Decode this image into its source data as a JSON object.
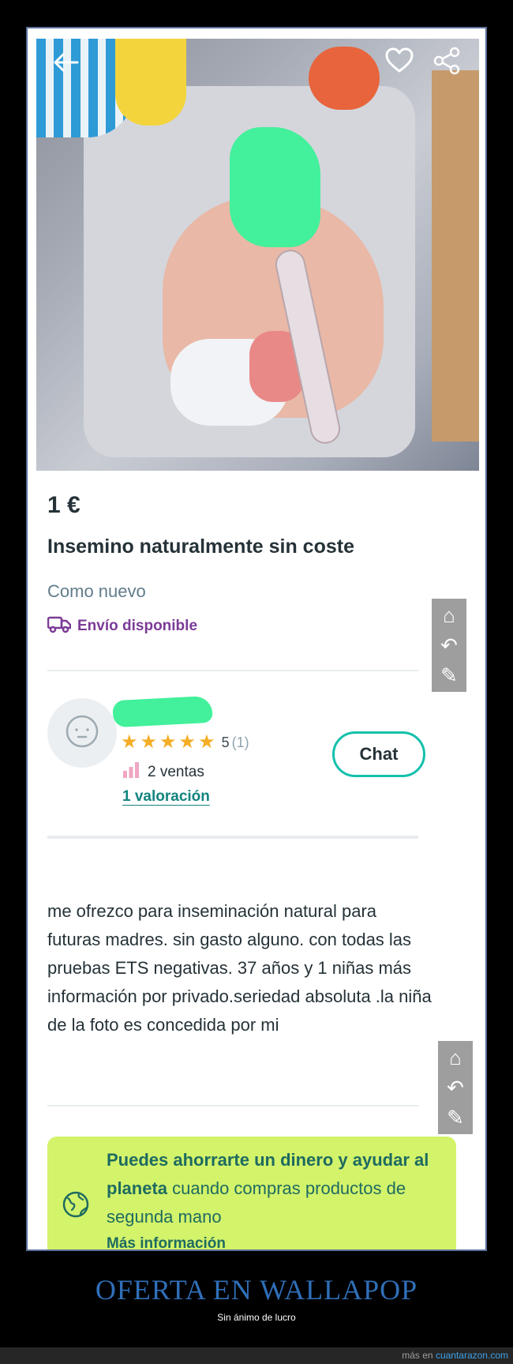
{
  "listing": {
    "price": "1 €",
    "title": "Insemino naturalmente sin coste",
    "condition": "Como nuevo",
    "shipping_label": "Envío disponible"
  },
  "seller": {
    "rating_value": "5",
    "rating_count": "(1)",
    "sales": "2 ventas",
    "reviews_link": "1 valoración",
    "stars": 5
  },
  "actions": {
    "chat_label": "Chat"
  },
  "description": "me ofrezco para inseminación natural para futuras madres. sin gasto alguno.  con todas las pruebas ETS negativas. 37 años y 1 niñas más información por privado.seriedad absoluta .la niña de la foto es concedida por mi",
  "eco_banner": {
    "bold_text": "Puedes ahorrarte un dinero y ayudar al planeta",
    "rest_text": " cuando compras productos de segunda mano",
    "link": "Más información"
  },
  "footer": {
    "title": "OFERTA EN WALLAPOP",
    "subtitle": "Sin ánimo de lucro",
    "bottom_prefix": "más en",
    "bottom_site": "cuantarazon.com"
  },
  "colors": {
    "accent": "#13c1ac",
    "shipping": "#7b3b96",
    "star": "#f4ad25",
    "eco_bg": "#d3f36b",
    "footer_title": "#2f6fb8"
  },
  "icons": {
    "back": "arrow-left-icon",
    "favorite": "heart-icon",
    "share": "share-icon",
    "shipping": "truck-icon",
    "avatar": "face-icon",
    "sales": "bar-chart-icon",
    "eco": "globe-icon"
  }
}
